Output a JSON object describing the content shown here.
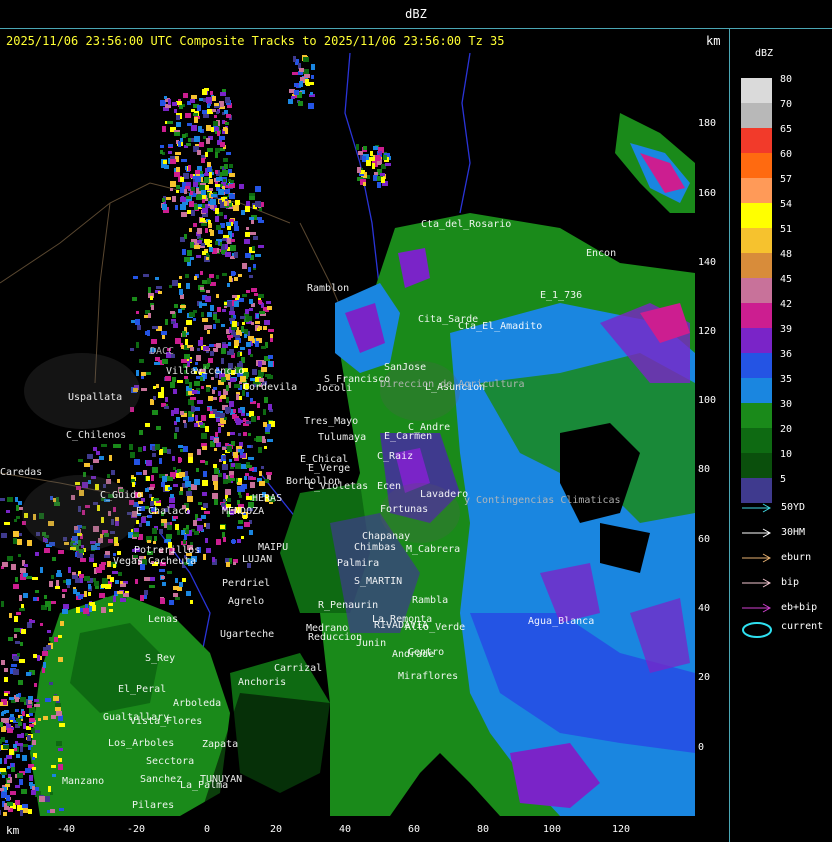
{
  "window": {
    "top_title": "dBZ"
  },
  "header": {
    "headline": "2025/11/06 23:56:00 UTC Composite Tracks to 2025/11/06 23:56:00 Tz 35",
    "km_top": "km",
    "km_bottom": "km"
  },
  "axes": {
    "y_ticks": [
      "180",
      "160",
      "140",
      "120",
      "100",
      "80",
      "60",
      "40",
      "20",
      "0"
    ],
    "x_ticks": [
      "-40",
      "-20",
      "0",
      "20",
      "40",
      "60",
      "80",
      "100",
      "120"
    ]
  },
  "legend": {
    "title": "dBZ",
    "levels": [
      {
        "label": "80",
        "color": "#dadada"
      },
      {
        "label": "70",
        "color": "#b8b8b8"
      },
      {
        "label": "65",
        "color": "#f23a2a"
      },
      {
        "label": "60",
        "color": "#ff6a10"
      },
      {
        "label": "57",
        "color": "#ff9a58"
      },
      {
        "label": "54",
        "color": "#ffff00"
      },
      {
        "label": "51",
        "color": "#f6c22e"
      },
      {
        "label": "48",
        "color": "#d88c3a"
      },
      {
        "label": "45",
        "color": "#c8729a"
      },
      {
        "label": "42",
        "color": "#cc1e90"
      },
      {
        "label": "39",
        "color": "#7a24c8"
      },
      {
        "label": "36",
        "color": "#2454e4"
      },
      {
        "label": "35",
        "color": "#1a86e0"
      },
      {
        "label": "30",
        "color": "#1a8a1a"
      },
      {
        "label": "20",
        "color": "#0e6a12"
      },
      {
        "label": "10",
        "color": "#0a4f0c"
      },
      {
        "label": "5",
        "color": "#3f3a8e"
      }
    ],
    "tracks": [
      {
        "label": "50YD",
        "color": "#3fd6e0"
      },
      {
        "label": "30HM",
        "color": "#ffffff"
      },
      {
        "label": "eburn",
        "color": "#e6b070"
      },
      {
        "label": "bip",
        "color": "#f2c6d0"
      },
      {
        "label": "eb+bip",
        "color": "#d040d0"
      }
    ],
    "current": {
      "label": "current",
      "color": "#2fe0f0"
    }
  },
  "places": [
    {
      "name": "Cta_del_Rosario",
      "dim": false
    },
    {
      "name": "Encon",
      "dim": false
    },
    {
      "name": "Ramblon",
      "dim": false
    },
    {
      "name": "E_1_736",
      "dim": false
    },
    {
      "name": "Cita_Sarde",
      "dim": false
    },
    {
      "name": "Cta_El_Amadito",
      "dim": false
    },
    {
      "name": "Villavicencio",
      "dim": false
    },
    {
      "name": "Uspallata",
      "dim": false
    },
    {
      "name": "C_Chilenos",
      "dim": false
    },
    {
      "name": "Caredas",
      "dim": false
    },
    {
      "name": "Cordevila",
      "dim": false
    },
    {
      "name": "S_Francisco",
      "dim": false
    },
    {
      "name": "Jocoli",
      "dim": false
    },
    {
      "name": "SanJose",
      "dim": false
    },
    {
      "name": "L_Asuncion",
      "dim": false
    },
    {
      "name": "Tres_Mayo",
      "dim": false
    },
    {
      "name": "C_Andre",
      "dim": false
    },
    {
      "name": "Tulumaya",
      "dim": false
    },
    {
      "name": "E_Carmen",
      "dim": false
    },
    {
      "name": "E_Chical",
      "dim": false
    },
    {
      "name": "E_Verge",
      "dim": false
    },
    {
      "name": "C_Raiz",
      "dim": false
    },
    {
      "name": "Borbollon",
      "dim": false
    },
    {
      "name": "C_Violetas",
      "dim": false
    },
    {
      "name": "Ecen",
      "dim": false
    },
    {
      "name": "Lavadero",
      "dim": false
    },
    {
      "name": "C_Guido",
      "dim": false
    },
    {
      "name": "E_Chalaco",
      "dim": false
    },
    {
      "name": "HERAS",
      "dim": false
    },
    {
      "name": "MENDOZA",
      "dim": false
    },
    {
      "name": "Fortunas",
      "dim": false
    },
    {
      "name": "Chapanay",
      "dim": false
    },
    {
      "name": "M_Cabrera",
      "dim": false
    },
    {
      "name": "Potrerillos",
      "dim": false
    },
    {
      "name": "Vegas",
      "dim": false
    },
    {
      "name": "Cacheuta",
      "dim": false
    },
    {
      "name": "MAIPU",
      "dim": false
    },
    {
      "name": "LUJAN",
      "dim": false
    },
    {
      "name": "Chimbas",
      "dim": false
    },
    {
      "name": "Palmira",
      "dim": false
    },
    {
      "name": "S_MARTIN",
      "dim": false
    },
    {
      "name": "Perdriel",
      "dim": false
    },
    {
      "name": "Agrelo",
      "dim": false
    },
    {
      "name": "R_Penaurin",
      "dim": false
    },
    {
      "name": "Rambla",
      "dim": false
    },
    {
      "name": "Ugarteche",
      "dim": false
    },
    {
      "name": "Medrano",
      "dim": false
    },
    {
      "name": "Reduccion",
      "dim": false
    },
    {
      "name": "RIVADAVIA",
      "dim": false
    },
    {
      "name": "Alto_Verde",
      "dim": false
    },
    {
      "name": "Junin",
      "dim": false
    },
    {
      "name": "Andrade",
      "dim": false
    },
    {
      "name": "Centro",
      "dim": false
    },
    {
      "name": "S_Rey",
      "dim": false
    },
    {
      "name": "Carrizal",
      "dim": false
    },
    {
      "name": "Anchoris",
      "dim": false
    },
    {
      "name": "Miraflores",
      "dim": false
    },
    {
      "name": "El_Peral",
      "dim": false
    },
    {
      "name": "Arboleda",
      "dim": false
    },
    {
      "name": "Gualtallary",
      "dim": false
    },
    {
      "name": "Zapata",
      "dim": false
    },
    {
      "name": "Los_Arboles",
      "dim": false
    },
    {
      "name": "Manzano",
      "dim": false
    },
    {
      "name": "Sanchez",
      "dim": false
    },
    {
      "name": "TUNUYAN",
      "dim": false
    },
    {
      "name": "Pilares",
      "dim": false
    },
    {
      "name": "La_Remonta",
      "dim": false
    },
    {
      "name": "Vista_Flores",
      "dim": false
    },
    {
      "name": "La_Palma",
      "dim": false
    },
    {
      "name": "Lenas",
      "dim": false
    },
    {
      "name": "Agua_Blanca",
      "dim": false
    },
    {
      "name": "Secctora",
      "dim": false
    },
    {
      "name": "DACC",
      "dim": true
    },
    {
      "name": "Direccion de Agricultura",
      "dim": true
    },
    {
      "name": "y Contingencias Climaticas",
      "dim": true
    }
  ]
}
